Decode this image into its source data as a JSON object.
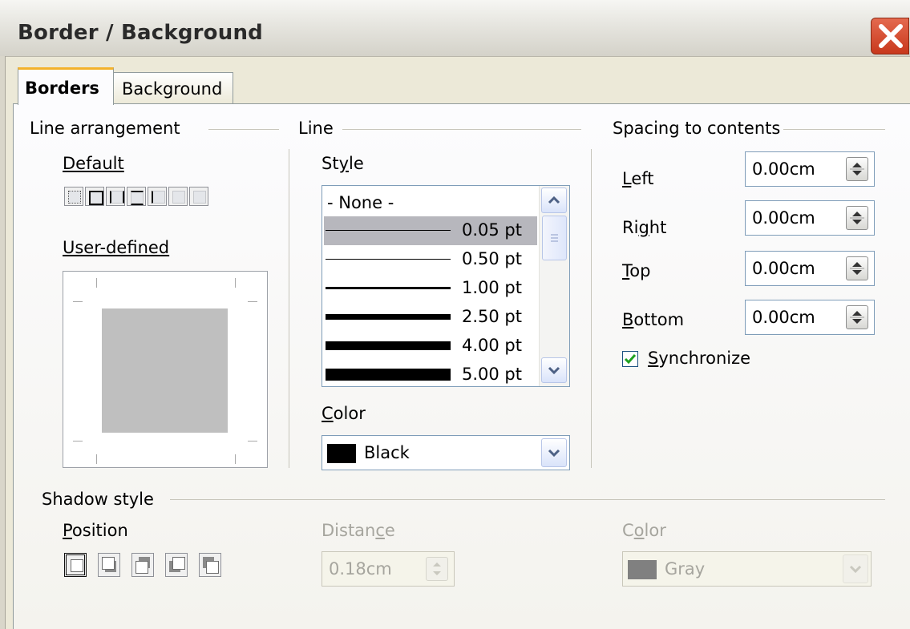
{
  "window": {
    "title": "Border / Background"
  },
  "tabs": [
    {
      "label": "Borders",
      "active": true
    },
    {
      "label": "Background",
      "active": false
    }
  ],
  "line_arrangement": {
    "title": "Line arrangement",
    "default_label": "Default",
    "user_defined_label": "User-defined"
  },
  "line": {
    "title": "Line",
    "style_label": "Style",
    "styles": [
      "- None -",
      "0.05 pt",
      "0.50 pt",
      "1.00 pt",
      "2.50 pt",
      "4.00 pt",
      "5.00 pt"
    ],
    "selected_style": "0.05 pt",
    "color_label": "Color",
    "color_value": "Black",
    "color_swatch": "#000000"
  },
  "spacing": {
    "title": "Spacing to contents",
    "left_label": "Left",
    "left_value": "0.00cm",
    "right_label": "Right",
    "right_value": "0.00cm",
    "top_label": "Top",
    "top_value": "0.00cm",
    "bottom_label": "Bottom",
    "bottom_value": "0.00cm",
    "synchronize_label": "Synchronize",
    "synchronize_checked": true
  },
  "shadow": {
    "title": "Shadow style",
    "position_label": "Position",
    "distance_label": "Distance",
    "distance_value": "0.18cm",
    "color_label": "Color",
    "color_value": "Gray",
    "color_swatch": "#808080"
  },
  "colors": {
    "tab_accent": "#f3b22c",
    "close_button": "#d04a2c",
    "selection": "#b7b7bd",
    "check_mark": "#21a121"
  }
}
